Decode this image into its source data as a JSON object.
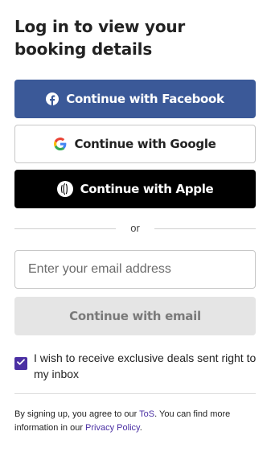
{
  "title": "Log in to view your booking details",
  "buttons": {
    "facebook": "Continue with Facebook",
    "google": "Continue with Google",
    "apple": "Continue with Apple",
    "email": "Continue with email"
  },
  "divider_text": "or",
  "email_input": {
    "placeholder": "Enter your email address",
    "value": ""
  },
  "optin": {
    "checked": true,
    "label": "I wish to receive exclusive deals sent right to my inbox"
  },
  "legal": {
    "prefix": "By signing up, you agree to our ",
    "tos_link": "ToS",
    "middle": ". You can find more information in our ",
    "privacy_link": "Privacy Policy",
    "suffix": "."
  },
  "colors": {
    "facebook": "#3b5998",
    "apple": "#000000",
    "accent": "#4a2fa3",
    "disabled_bg": "#e5e5e5"
  },
  "icons": [
    "facebook-icon",
    "google-icon",
    "apple-icon",
    "check-icon"
  ]
}
